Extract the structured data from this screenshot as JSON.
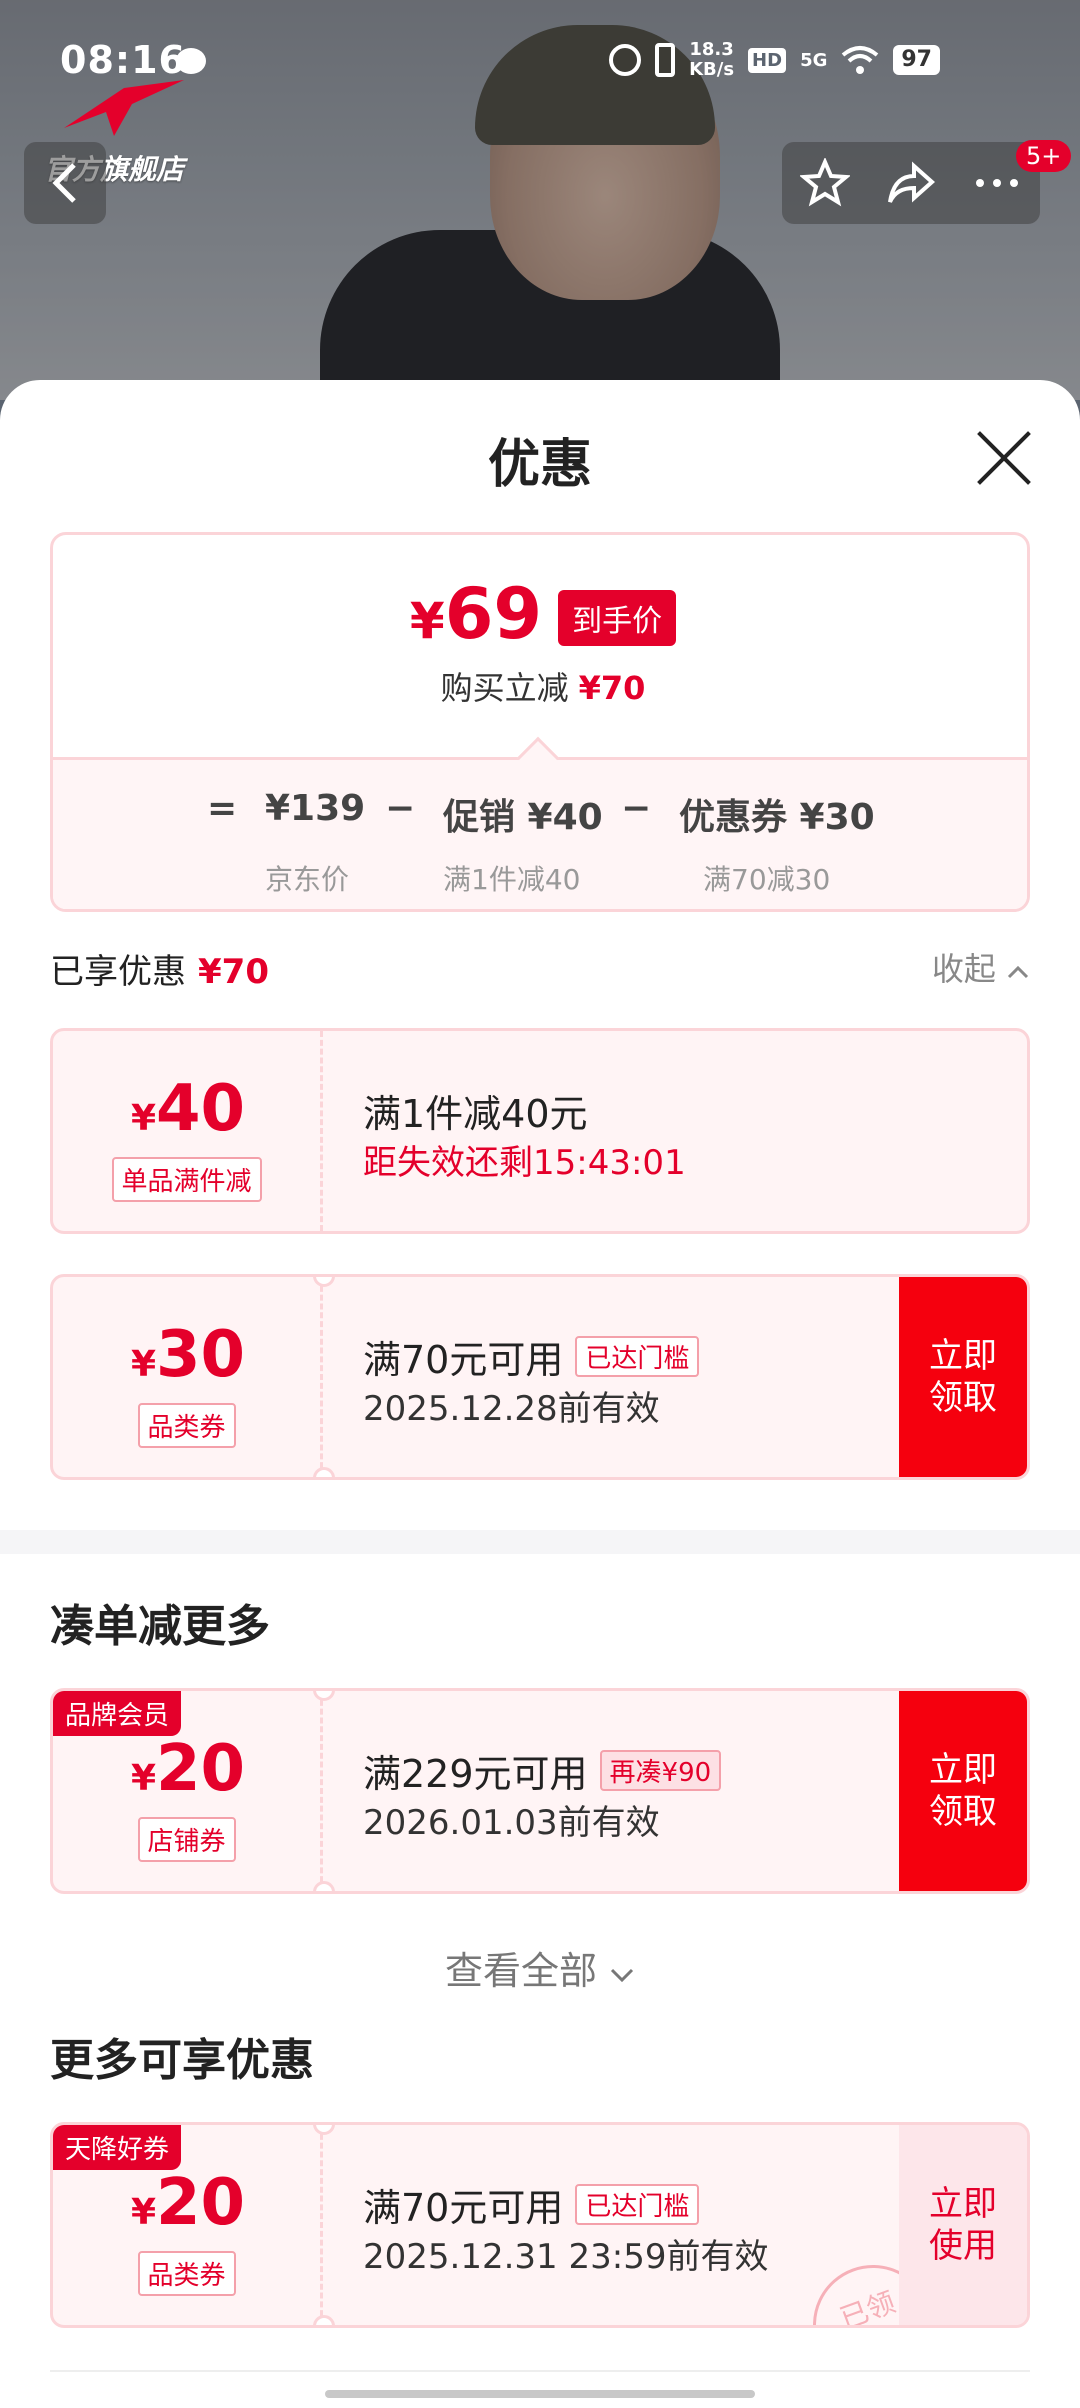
{
  "status_bar": {
    "time": "08:16",
    "net_speed_value": "18.3",
    "net_speed_unit": "KB/s",
    "hd": "HD",
    "network": "5G",
    "battery": "97"
  },
  "brand": {
    "logo_text": "官方旗舰店"
  },
  "nav": {
    "badge": "5+"
  },
  "sheet": {
    "title": "优惠"
  },
  "summary": {
    "currency": "¥",
    "final_price": "69",
    "final_price_tag": "到手价",
    "reduce_label": "购买立减",
    "reduce_amount": "¥70",
    "calc": {
      "equals": "=",
      "minus": "−",
      "jd_price": "¥139",
      "jd_price_label": "京东价",
      "promo": "促销 ¥40",
      "promo_label": "满1件减40",
      "coupon": "优惠券 ¥30",
      "coupon_label": "满70减30"
    }
  },
  "enjoyed": {
    "label": "已享优惠",
    "amount": "¥70",
    "collapse": "收起"
  },
  "applied_coupons": [
    {
      "currency": "¥",
      "amount": "40",
      "kind": "单品满件减",
      "title": "满1件减40元",
      "sub": "距失效还剩15:43:01"
    },
    {
      "currency": "¥",
      "amount": "30",
      "kind": "品类券",
      "title": "满70元可用",
      "pill": "已达门槛",
      "sub": "2025.12.28前有效",
      "button": "立即领取"
    }
  ],
  "more_section": {
    "title": "凑单减更多",
    "coupon": {
      "corner": "品牌会员",
      "currency": "¥",
      "amount": "20",
      "kind": "店铺券",
      "title": "满229元可用",
      "pill": "再凑¥90",
      "sub": "2026.01.03前有效",
      "button": "立即领取"
    },
    "view_all": "查看全部"
  },
  "extra_section": {
    "title": "更多可享优惠",
    "coupon": {
      "corner": "天降好券",
      "currency": "¥",
      "amount": "20",
      "kind": "品类券",
      "title": "满70元可用",
      "pill": "已达门槛",
      "sub": "2025.12.31 23:59前有效",
      "button": "立即使用",
      "stamp": "已领"
    }
  },
  "colors": {
    "accent": "#e4002b",
    "button_red": "#f5000e",
    "coupon_bg": "#fff4f5",
    "coupon_border": "#fbd4d8"
  },
  "icons": [
    "chat-bubble-icon",
    "alarm-icon",
    "vibrate-icon",
    "wifi-icon",
    "back-arrow-icon",
    "star-icon",
    "share-icon",
    "more-icon",
    "close-icon",
    "chevron-up-icon",
    "chevron-down-icon"
  ]
}
